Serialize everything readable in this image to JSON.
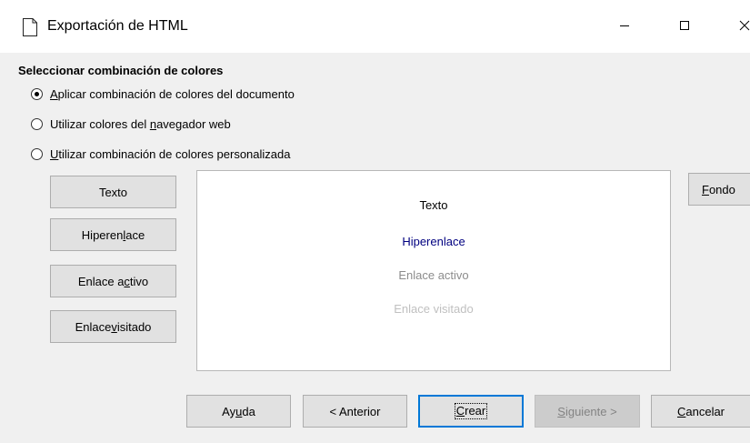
{
  "window": {
    "title": "Exportación de HTML",
    "icons": {
      "app": "document-icon",
      "minimize": "minimize-icon",
      "maximize": "maximize-icon",
      "close": "close-icon"
    }
  },
  "section": {
    "label": "Seleccionar combinación de colores"
  },
  "radios": [
    {
      "prefix": "",
      "accel": "A",
      "suffix": "plicar combinación de colores del documento",
      "checked": true
    },
    {
      "prefix": "Utilizar colores del ",
      "accel": "n",
      "suffix": "avegador web",
      "checked": false
    },
    {
      "prefix": "",
      "accel": "U",
      "suffix": "tilizar combinación de colores personalizada",
      "checked": false
    }
  ],
  "color_buttons": {
    "texto": {
      "prefix": "Texto",
      "accel": "",
      "suffix": ""
    },
    "hiperenlace": {
      "prefix": "Hiperen",
      "accel": "l",
      "suffix": "ace"
    },
    "enlace_activo": {
      "prefix": "Enlace a",
      "accel": "c",
      "suffix": "tivo"
    },
    "enlace_visitado": {
      "prefix": "Enlace ",
      "accel": "v",
      "suffix": "isitado"
    },
    "fondo": {
      "prefix": "",
      "accel": "F",
      "suffix": "ondo"
    }
  },
  "preview": {
    "texto": "Texto",
    "hiperenlace": "Hiperenlace",
    "enlace_activo": "Enlace activo",
    "enlace_visitado": "Enlace visitado",
    "colors": {
      "texto": "#000000",
      "hiperenlace": "#000080",
      "enlace_activo": "#8c8c8c",
      "enlace_visitado": "#c0c0c0"
    }
  },
  "footer": {
    "ayuda": {
      "prefix": "Ay",
      "accel": "u",
      "suffix": "da"
    },
    "anterior": {
      "prefix": "< Anterior",
      "accel": "",
      "suffix": ""
    },
    "crear": {
      "prefix": "",
      "accel": "C",
      "suffix": "rear"
    },
    "siguiente": {
      "prefix": "",
      "accel": "S",
      "suffix": "iguiente >"
    },
    "cancelar": {
      "prefix": "",
      "accel": "C",
      "suffix": "ancelar"
    }
  },
  "colors": {
    "accent": "#0078d7",
    "dialog_bg": "#f0f0f0",
    "button_bg": "#e1e1e1",
    "button_border": "#adadad"
  }
}
